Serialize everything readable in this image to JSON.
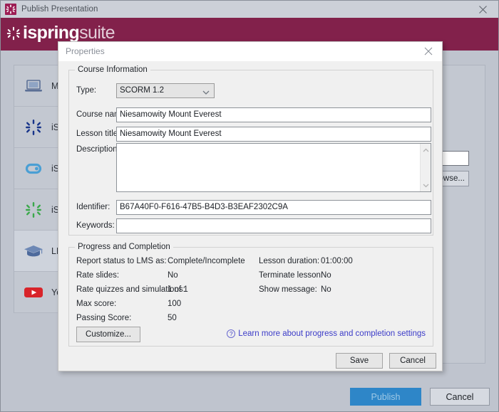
{
  "window": {
    "title": "Publish Presentation",
    "app_icon": "ispring-starburst-icon",
    "close_icon": "close-icon",
    "brand": {
      "name_bold": "ispring",
      "name_light": "suite",
      "mark": "starburst-icon",
      "bg": "#82214b"
    }
  },
  "sidebar": {
    "items": [
      {
        "label": "My Computer",
        "icon": "laptop-icon",
        "selected": false
      },
      {
        "label": "iSpring Cloud",
        "icon": "ispring-starburst-blue-icon",
        "selected": false
      },
      {
        "label": "iSpring Space",
        "icon": "infinity-loop-icon",
        "selected": false
      },
      {
        "label": "iSpring Learn",
        "icon": "ispring-starburst-green-icon",
        "selected": false
      },
      {
        "label": "LMS",
        "icon": "graduation-cap-icon",
        "selected": true
      },
      {
        "label": "YouTube",
        "icon": "youtube-icon",
        "selected": false
      }
    ]
  },
  "right_panel": {
    "destination_value": "",
    "browse_label": "Browse..."
  },
  "bottom_bar": {
    "publish_label": "Publish",
    "cancel_label": "Cancel",
    "publish_color": "#2e86c8"
  },
  "dialog": {
    "title": "Properties",
    "close_icon": "close-icon",
    "course_information": {
      "legend": "Course Information",
      "type_label": "Type:",
      "type_value": "SCORM 1.2",
      "type_arrow_icon": "chevron-down-icon",
      "course_name_label": "Course name:",
      "course_name_value": "Niesamowity Mount Everest",
      "lesson_title_label": "Lesson title:",
      "lesson_title_value": "Niesamowity Mount Everest",
      "description_label": "Description:",
      "description_value": "",
      "scroll_up_icon": "chevron-up-icon",
      "scroll_down_icon": "chevron-down-icon",
      "identifier_label": "Identifier:",
      "identifier_value": "B67A40F0-F616-47B5-B4D3-B3EAF2302C9A",
      "keywords_label": "Keywords:",
      "keywords_value": ""
    },
    "progress_and_completion": {
      "legend": "Progress and Completion",
      "left_rows": [
        {
          "label": "Report status to LMS as:",
          "value": "Complete/Incomplete"
        },
        {
          "label": "Rate slides:",
          "value": "No"
        },
        {
          "label": "Rate quizzes and simulations:",
          "value": "1 of 1"
        },
        {
          "label": "Max score:",
          "value": "100"
        },
        {
          "label": "Passing Score:",
          "value": "50"
        }
      ],
      "right_rows": [
        {
          "label": "Lesson duration:",
          "value": "01:00:00"
        },
        {
          "label": "Terminate lesson:",
          "value": "No"
        },
        {
          "label": "Show message:",
          "value": "No"
        }
      ],
      "customize_label": "Customize...",
      "learn_more_label": "Learn more about progress and completion settings",
      "learn_more_icon": "question-mark-icon",
      "link_color": "#3c3cc8"
    },
    "save_label": "Save",
    "cancel_label": "Cancel"
  }
}
